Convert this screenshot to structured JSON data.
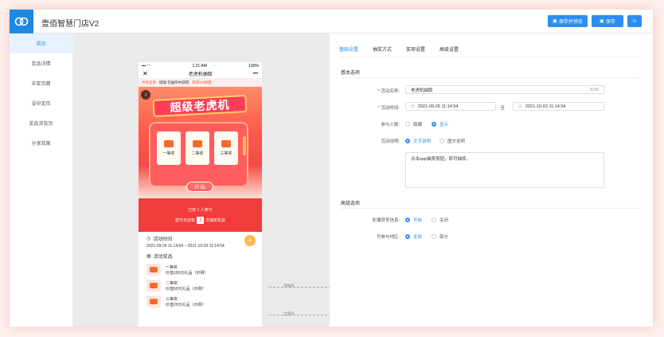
{
  "app": {
    "title": "壹佰智慧门店V2"
  },
  "toolbar": {
    "save_preview_label": "保存并预览",
    "save_label": "保存",
    "extra_label": "⊙"
  },
  "sidebar": {
    "items": [
      {
        "label": "首页",
        "active": true
      },
      {
        "label": "奖品详情",
        "active": false
      },
      {
        "label": "中奖页面",
        "active": false
      },
      {
        "label": "没中奖页",
        "active": false
      },
      {
        "label": "奖品浏览页",
        "active": false
      },
      {
        "label": "分享效果",
        "active": false
      }
    ]
  },
  "phone": {
    "time": "1:21 AM",
    "battery": "100%",
    "title": "老虎机抽取",
    "close": "✕",
    "more": "•••",
    "ticker_tag": "中奖名单",
    "ticker_text": "瑞瑞 在抽奖中获得",
    "ticker_prize": "获得VR眼镜",
    "big_title": "超级老虎机",
    "reels": [
      "一等奖",
      "二等奖",
      "三等奖"
    ],
    "start": "开 始",
    "participants_prefix": "已有",
    "participants_count": "1",
    "participants_suffix": "人参与",
    "chance_prefix": "您今天还有",
    "chance_count": "3",
    "chance_suffix": "次抽奖机会",
    "time_label": "活动时间",
    "time_range": "2021-09-26 11:14:54 ~ 2021-10-03 11:14:54",
    "prize_label": "活动奖品",
    "prizes": [
      {
        "name": "一等奖",
        "desc": "价值100元礼品（示例）"
      },
      {
        "name": "二等奖",
        "desc": "价值50元礼品（示例）"
      },
      {
        "name": "三等奖",
        "desc": "价值20元礼品（示例）"
      }
    ]
  },
  "markers": {
    "fold": "常规屏",
    "full": "全面屏"
  },
  "panel": {
    "tabs": [
      "基础设置",
      "抽奖方式",
      "奖项设置",
      "高级设置"
    ],
    "section_basic": "基本选项",
    "name_label": "* 活动名称:",
    "name_value": "老虎机抽取",
    "name_count": "5/30",
    "time_label": "* 活动时间:",
    "start_time": "2021-09-26 11:14:54",
    "to": "至",
    "end_time": "2021-10-03 11:14:54",
    "people_label": "参与人数:",
    "people_opts": [
      "隐藏",
      "显示"
    ],
    "desc_label": "活动说明:",
    "desc_opts": [
      "文字说明",
      "图文说明"
    ],
    "desc_text": "点击opp抽奖按钮，即可抽奖。",
    "section_adv": "高级选项",
    "rotate_label": "轮播获奖信息:",
    "rotate_opts": [
      "开启",
      "关闭"
    ],
    "region_label": "可参与地区:",
    "region_opts": [
      "全部",
      "部分"
    ]
  },
  "colors": {
    "accent": "#2d8cf0",
    "hero": "#f23b3b",
    "brand": "#1e88e5"
  }
}
